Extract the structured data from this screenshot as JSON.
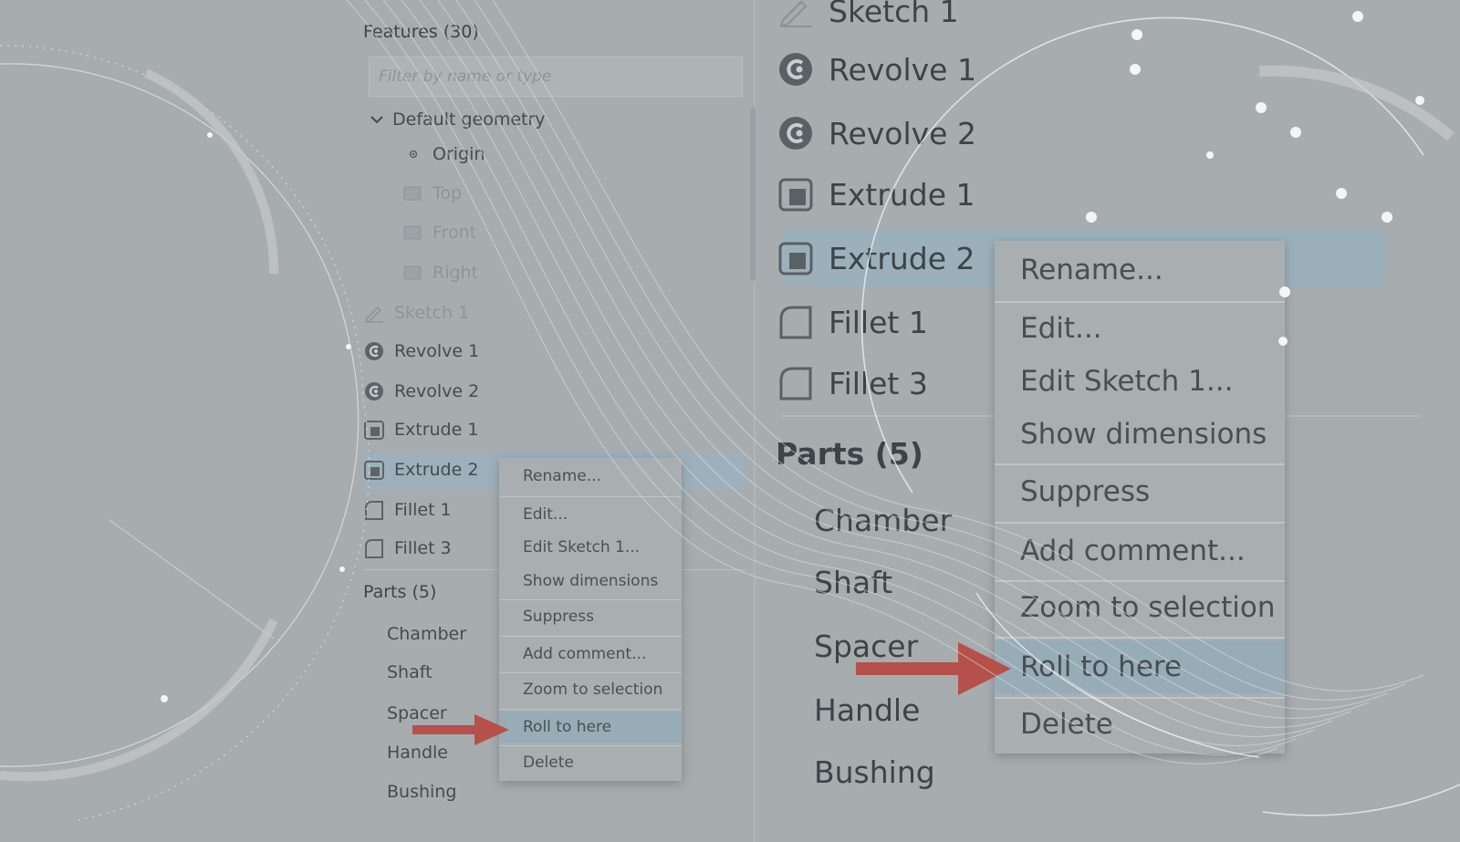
{
  "features_title": "Features (30)",
  "filter_placeholder": "Filter by name or type",
  "default_geometry": "Default geometry",
  "origin": "Origin",
  "planes": [
    "Top",
    "Front",
    "Right"
  ],
  "features": {
    "sketch1": "Sketch 1",
    "revolve1": "Revolve 1",
    "revolve2": "Revolve 2",
    "extrude1": "Extrude 1",
    "extrude2": "Extrude 2",
    "fillet1": "Fillet 1",
    "fillet3": "Fillet 3"
  },
  "parts_title": "Parts (5)",
  "parts": [
    "Chamber",
    "Shaft",
    "Spacer",
    "Handle",
    "Bushing"
  ],
  "context_menu": {
    "rename": "Rename...",
    "edit": "Edit...",
    "edit_sketch": "Edit Sketch 1...",
    "show_dimensions": "Show dimensions",
    "suppress": "Suppress",
    "add_comment": "Add comment...",
    "zoom_to_selection": "Zoom to selection",
    "roll_to_here": "Roll to here",
    "delete": "Delete"
  },
  "colors": {
    "background": "#a7acaf",
    "selection": "#9eb0bb",
    "arrow": "#b5514a"
  },
  "icons": {
    "sketch": "pencil-icon",
    "revolve": "revolve-icon",
    "extrude": "extrude-icon",
    "fillet": "fillet-icon",
    "plane": "plane-icon",
    "origin": "origin-icon",
    "chevron": "chevron-down-icon",
    "pointer": "red-arrow-icon"
  }
}
